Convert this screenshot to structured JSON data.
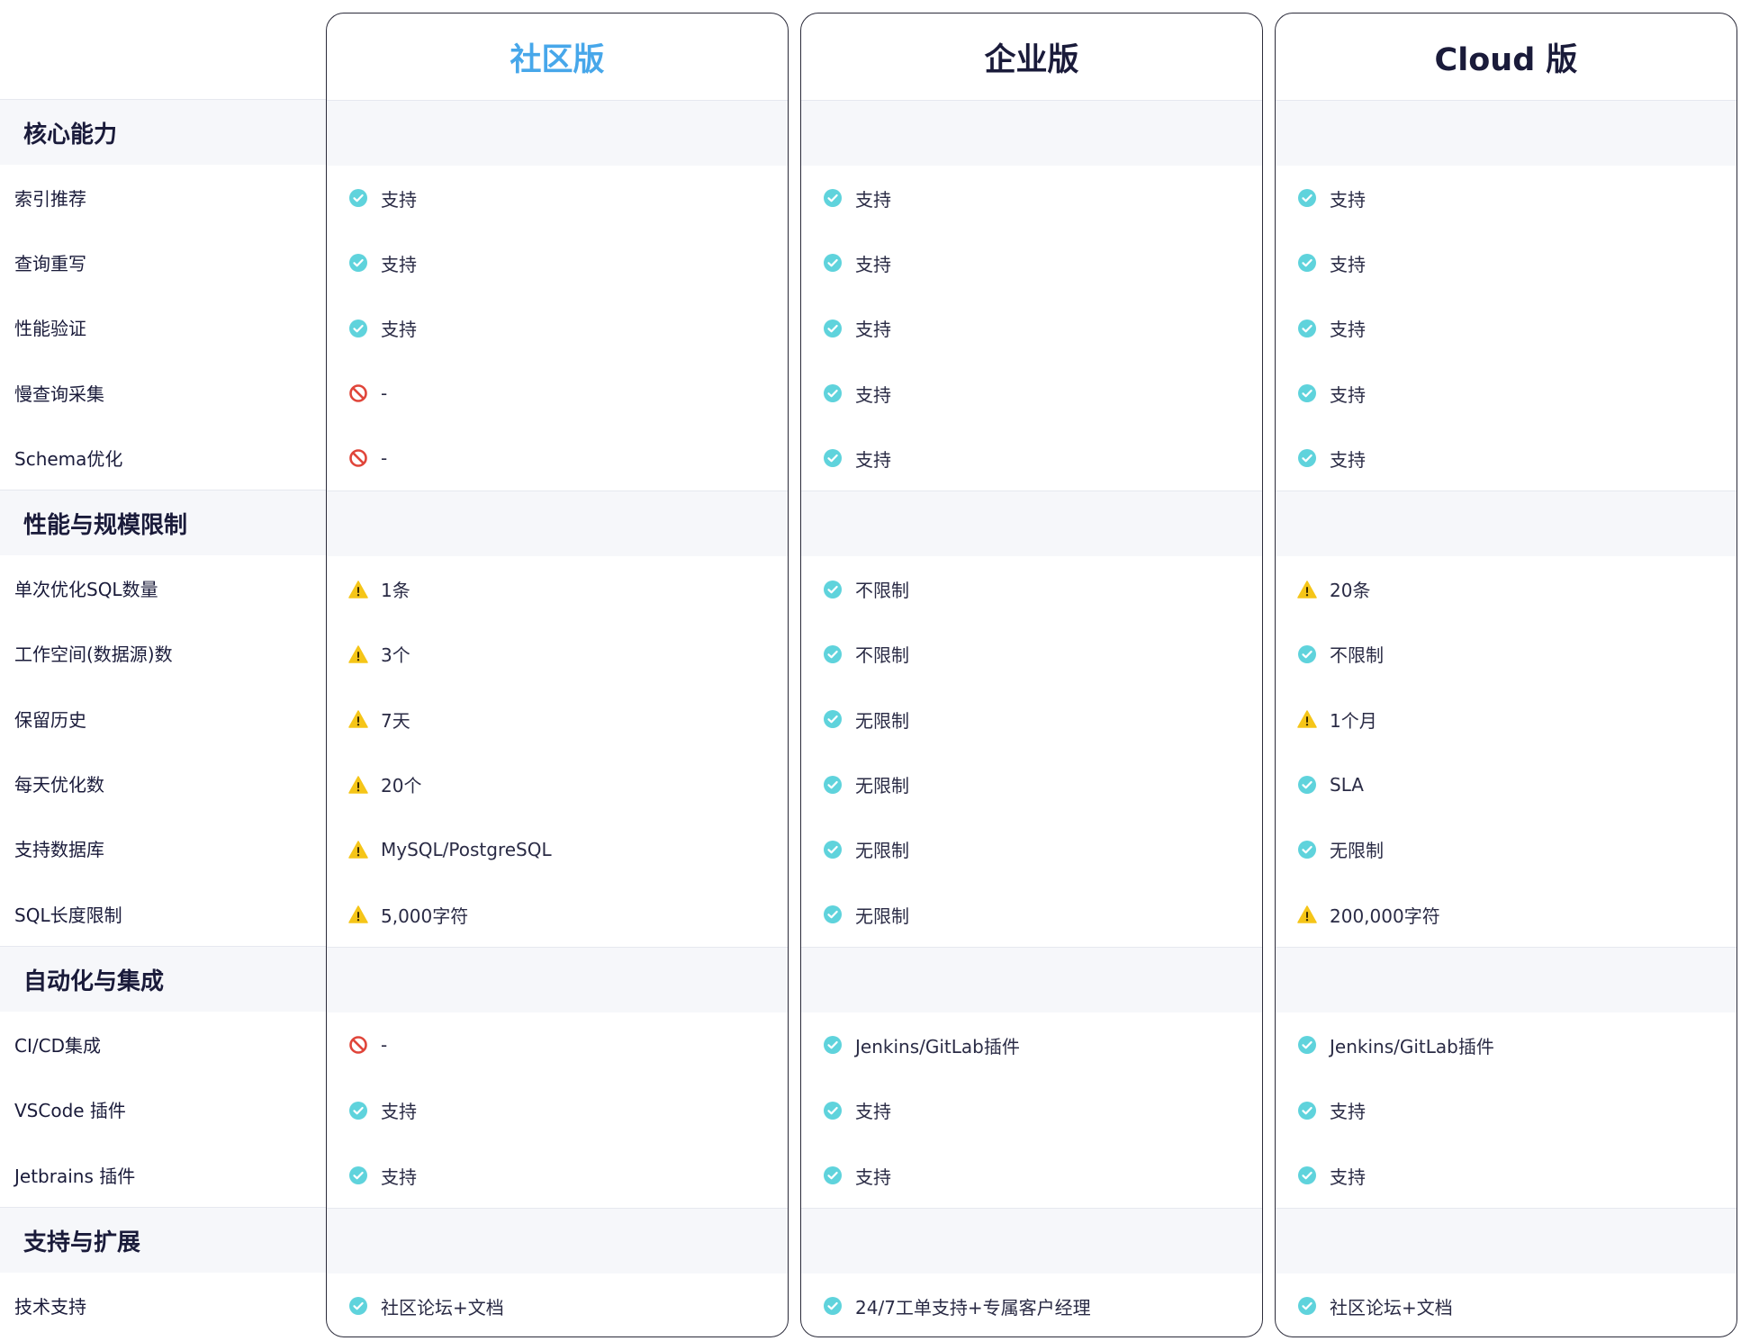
{
  "colors": {
    "accent": "#47a7ea",
    "check": "#5fd3dc",
    "warn": "#f5c518",
    "no": "#e0453a"
  },
  "plans": [
    {
      "key": "community",
      "name": "社区版",
      "highlight": true
    },
    {
      "key": "enterprise",
      "name": "企业版",
      "highlight": false
    },
    {
      "key": "cloud",
      "name": "Cloud 版",
      "highlight": false
    }
  ],
  "sections": [
    {
      "title": "核心能力",
      "rows": [
        {
          "label": "索引推荐",
          "cells": [
            {
              "icon": "check",
              "text": "支持"
            },
            {
              "icon": "check",
              "text": "支持"
            },
            {
              "icon": "check",
              "text": "支持"
            }
          ]
        },
        {
          "label": "查询重写",
          "cells": [
            {
              "icon": "check",
              "text": "支持"
            },
            {
              "icon": "check",
              "text": "支持"
            },
            {
              "icon": "check",
              "text": "支持"
            }
          ]
        },
        {
          "label": "性能验证",
          "cells": [
            {
              "icon": "check",
              "text": "支持"
            },
            {
              "icon": "check",
              "text": "支持"
            },
            {
              "icon": "check",
              "text": "支持"
            }
          ]
        },
        {
          "label": "慢查询采集",
          "cells": [
            {
              "icon": "no",
              "text": "-"
            },
            {
              "icon": "check",
              "text": "支持"
            },
            {
              "icon": "check",
              "text": "支持"
            }
          ]
        },
        {
          "label": "Schema优化",
          "cells": [
            {
              "icon": "no",
              "text": "-"
            },
            {
              "icon": "check",
              "text": "支持"
            },
            {
              "icon": "check",
              "text": "支持"
            }
          ]
        }
      ]
    },
    {
      "title": "性能与规模限制",
      "rows": [
        {
          "label": "单次优化SQL数量",
          "cells": [
            {
              "icon": "warn",
              "text": "1条"
            },
            {
              "icon": "check",
              "text": "不限制"
            },
            {
              "icon": "warn",
              "text": "20条"
            }
          ]
        },
        {
          "label": "工作空间(数据源)数",
          "cells": [
            {
              "icon": "warn",
              "text": "3个"
            },
            {
              "icon": "check",
              "text": "不限制"
            },
            {
              "icon": "check",
              "text": "不限制"
            }
          ]
        },
        {
          "label": "保留历史",
          "cells": [
            {
              "icon": "warn",
              "text": "7天"
            },
            {
              "icon": "check",
              "text": "无限制"
            },
            {
              "icon": "warn",
              "text": "1个月"
            }
          ]
        },
        {
          "label": "每天优化数",
          "cells": [
            {
              "icon": "warn",
              "text": "20个"
            },
            {
              "icon": "check",
              "text": "无限制"
            },
            {
              "icon": "check",
              "text": "SLA"
            }
          ]
        },
        {
          "label": "支持数据库",
          "cells": [
            {
              "icon": "warn",
              "text": "MySQL/PostgreSQL"
            },
            {
              "icon": "check",
              "text": "无限制"
            },
            {
              "icon": "check",
              "text": "无限制"
            }
          ]
        },
        {
          "label": "SQL长度限制",
          "cells": [
            {
              "icon": "warn",
              "text": "5,000字符"
            },
            {
              "icon": "check",
              "text": "无限制"
            },
            {
              "icon": "warn",
              "text": "200,000字符"
            }
          ]
        }
      ]
    },
    {
      "title": "自动化与集成",
      "rows": [
        {
          "label": "CI/CD集成",
          "cells": [
            {
              "icon": "no",
              "text": "-"
            },
            {
              "icon": "check",
              "text": "Jenkins/GitLab插件"
            },
            {
              "icon": "check",
              "text": "Jenkins/GitLab插件"
            }
          ]
        },
        {
          "label": "VSCode 插件",
          "cells": [
            {
              "icon": "check",
              "text": "支持"
            },
            {
              "icon": "check",
              "text": "支持"
            },
            {
              "icon": "check",
              "text": "支持"
            }
          ]
        },
        {
          "label": "Jetbrains 插件",
          "cells": [
            {
              "icon": "check",
              "text": "支持"
            },
            {
              "icon": "check",
              "text": "支持"
            },
            {
              "icon": "check",
              "text": "支持"
            }
          ]
        }
      ]
    },
    {
      "title": "支持与扩展",
      "rows": [
        {
          "label": "技术支持",
          "cells": [
            {
              "icon": "check",
              "text": "社区论坛+文档"
            },
            {
              "icon": "check",
              "text": "24/7工单支持+专属客户经理"
            },
            {
              "icon": "check",
              "text": "社区论坛+文档"
            }
          ]
        }
      ]
    }
  ]
}
